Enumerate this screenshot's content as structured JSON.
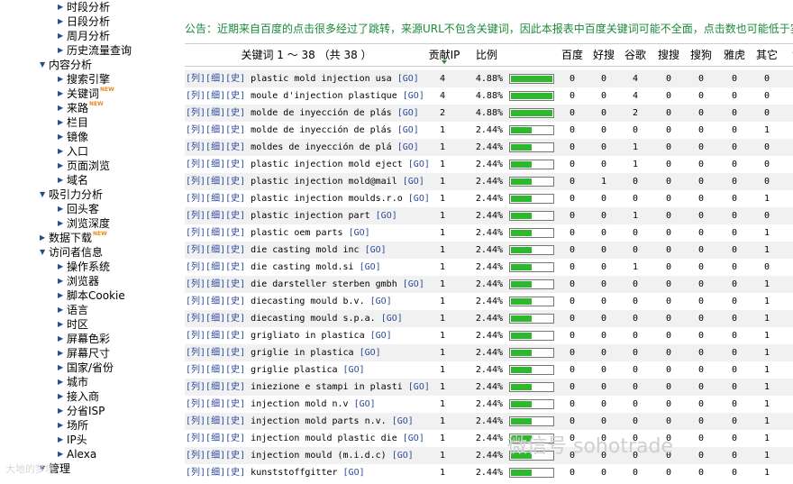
{
  "sidebar": {
    "items": [
      {
        "label": "时段分析",
        "level": 2,
        "arrow": "right"
      },
      {
        "label": "日段分析",
        "level": 2,
        "arrow": "right"
      },
      {
        "label": "周月分析",
        "level": 2,
        "arrow": "right"
      },
      {
        "label": "历史流量查询",
        "level": 2,
        "arrow": "right"
      },
      {
        "label": "内容分析",
        "level": 1,
        "arrow": "down"
      },
      {
        "label": "搜索引擎",
        "level": 2,
        "arrow": "right"
      },
      {
        "label": "关键词",
        "level": 2,
        "arrow": "right",
        "badge": "NEW"
      },
      {
        "label": "来路",
        "level": 2,
        "arrow": "right",
        "badge": "NEW"
      },
      {
        "label": "栏目",
        "level": 2,
        "arrow": "right"
      },
      {
        "label": "镜像",
        "level": 2,
        "arrow": "right"
      },
      {
        "label": "入口",
        "level": 2,
        "arrow": "right"
      },
      {
        "label": "页面浏览",
        "level": 2,
        "arrow": "right"
      },
      {
        "label": "域名",
        "level": 2,
        "arrow": "right"
      },
      {
        "label": "吸引力分析",
        "level": 1,
        "arrow": "down"
      },
      {
        "label": "回头客",
        "level": 2,
        "arrow": "right"
      },
      {
        "label": "浏览深度",
        "level": 2,
        "arrow": "right"
      },
      {
        "label": "数据下载",
        "level": 1,
        "arrow": "right",
        "badge": "NEW"
      },
      {
        "label": "访问者信息",
        "level": 1,
        "arrow": "down"
      },
      {
        "label": "操作系统",
        "level": 2,
        "arrow": "right"
      },
      {
        "label": "浏览器",
        "level": 2,
        "arrow": "right"
      },
      {
        "label": "脚本Cookie",
        "level": 2,
        "arrow": "right"
      },
      {
        "label": "语言",
        "level": 2,
        "arrow": "right"
      },
      {
        "label": "时区",
        "level": 2,
        "arrow": "right"
      },
      {
        "label": "屏幕色彩",
        "level": 2,
        "arrow": "right"
      },
      {
        "label": "屏幕尺寸",
        "level": 2,
        "arrow": "right"
      },
      {
        "label": "国家/省份",
        "level": 2,
        "arrow": "right"
      },
      {
        "label": "城市",
        "level": 2,
        "arrow": "right"
      },
      {
        "label": "接入商",
        "level": 2,
        "arrow": "right"
      },
      {
        "label": "分省ISP",
        "level": 2,
        "arrow": "right"
      },
      {
        "label": "场所",
        "level": 2,
        "arrow": "right"
      },
      {
        "label": "IP头",
        "level": 2,
        "arrow": "right"
      },
      {
        "label": "Alexa",
        "level": 2,
        "arrow": "right"
      },
      {
        "label": "管理",
        "level": 1,
        "arrow": "down"
      }
    ]
  },
  "notice": "公告：近期来自百度的点击很多经过了跳转，来源URL不包含关键词，因此本报表中百度关键词可能不全面，点击数也可能低于实",
  "header": {
    "keyword": "关键词 1 ～ 38 （共 38 ）",
    "ip": "贡献IP",
    "ratio": "比例",
    "engines": [
      "百度",
      "好搜",
      "谷歌",
      "搜搜",
      "搜狗",
      "雅虎",
      "其它",
      "贡"
    ]
  },
  "link_labels": {
    "col": "[列]",
    "detail": "[细]",
    "history": "[史]",
    "go": "[GO]"
  },
  "rows": [
    {
      "keyword": "plastic mold injection usa",
      "ip": 4,
      "pct": "4.88%",
      "share": 1.0,
      "engines": [
        0,
        0,
        4,
        0,
        0,
        0,
        0
      ]
    },
    {
      "keyword": "moule d'injection plastique",
      "ip": 4,
      "pct": "4.88%",
      "share": 1.0,
      "engines": [
        0,
        0,
        4,
        0,
        0,
        0,
        0
      ]
    },
    {
      "keyword": "molde de inyección de plás",
      "ip": 2,
      "pct": "4.88%",
      "share": 1.0,
      "engines": [
        0,
        0,
        2,
        0,
        0,
        0,
        0
      ]
    },
    {
      "keyword": "molde de inyección de plás",
      "ip": 1,
      "pct": "2.44%",
      "share": 0.5,
      "engines": [
        0,
        0,
        0,
        0,
        0,
        0,
        1
      ]
    },
    {
      "keyword": "moldes de inyección de plá",
      "ip": 1,
      "pct": "2.44%",
      "share": 0.5,
      "engines": [
        0,
        0,
        1,
        0,
        0,
        0,
        0
      ]
    },
    {
      "keyword": "plastic injection mold eject",
      "ip": 1,
      "pct": "2.44%",
      "share": 0.5,
      "engines": [
        0,
        0,
        1,
        0,
        0,
        0,
        0
      ]
    },
    {
      "keyword": "plastic injection mold@mail",
      "ip": 1,
      "pct": "2.44%",
      "share": 0.5,
      "engines": [
        0,
        1,
        0,
        0,
        0,
        0,
        0
      ]
    },
    {
      "keyword": "plastic injection moulds.r.o",
      "ip": 1,
      "pct": "2.44%",
      "share": 0.5,
      "engines": [
        0,
        0,
        0,
        0,
        0,
        0,
        1
      ]
    },
    {
      "keyword": "plastic injection part",
      "ip": 1,
      "pct": "2.44%",
      "share": 0.5,
      "engines": [
        0,
        0,
        1,
        0,
        0,
        0,
        0
      ]
    },
    {
      "keyword": "plastic oem parts",
      "ip": 1,
      "pct": "2.44%",
      "share": 0.5,
      "engines": [
        0,
        0,
        0,
        0,
        0,
        0,
        1
      ]
    },
    {
      "keyword": "die casting mold inc",
      "ip": 1,
      "pct": "2.44%",
      "share": 0.5,
      "engines": [
        0,
        0,
        0,
        0,
        0,
        0,
        1
      ]
    },
    {
      "keyword": "die casting mold.si",
      "ip": 1,
      "pct": "2.44%",
      "share": 0.5,
      "engines": [
        0,
        0,
        1,
        0,
        0,
        0,
        0
      ]
    },
    {
      "keyword": "die darsteller sterben gmbh",
      "ip": 1,
      "pct": "2.44%",
      "share": 0.5,
      "engines": [
        0,
        0,
        0,
        0,
        0,
        0,
        1
      ]
    },
    {
      "keyword": "diecasting mould b.v.",
      "ip": 1,
      "pct": "2.44%",
      "share": 0.5,
      "engines": [
        0,
        0,
        0,
        0,
        0,
        0,
        1
      ]
    },
    {
      "keyword": "diecasting mould s.p.a.",
      "ip": 1,
      "pct": "2.44%",
      "share": 0.5,
      "engines": [
        0,
        0,
        0,
        0,
        0,
        0,
        1
      ]
    },
    {
      "keyword": "grigliato in plastica",
      "ip": 1,
      "pct": "2.44%",
      "share": 0.5,
      "engines": [
        0,
        0,
        0,
        0,
        0,
        0,
        1
      ]
    },
    {
      "keyword": "griglie in plastica",
      "ip": 1,
      "pct": "2.44%",
      "share": 0.5,
      "engines": [
        0,
        0,
        0,
        0,
        0,
        0,
        1
      ]
    },
    {
      "keyword": "griglie plastica",
      "ip": 1,
      "pct": "2.44%",
      "share": 0.5,
      "engines": [
        0,
        0,
        0,
        0,
        0,
        0,
        1
      ]
    },
    {
      "keyword": "iniezione e stampi in plasti",
      "ip": 1,
      "pct": "2.44%",
      "share": 0.5,
      "engines": [
        0,
        0,
        0,
        0,
        0,
        0,
        1
      ]
    },
    {
      "keyword": "injection mold n.v",
      "ip": 1,
      "pct": "2.44%",
      "share": 0.5,
      "engines": [
        0,
        0,
        0,
        0,
        0,
        0,
        1
      ]
    },
    {
      "keyword": "injection mold parts n.v.",
      "ip": 1,
      "pct": "2.44%",
      "share": 0.5,
      "engines": [
        0,
        0,
        0,
        0,
        0,
        0,
        1
      ]
    },
    {
      "keyword": "injection mould plastic die",
      "ip": 1,
      "pct": "2.44%",
      "share": 0.5,
      "engines": [
        0,
        0,
        0,
        0,
        0,
        0,
        1
      ]
    },
    {
      "keyword": "injection mould (m.i.d.c)",
      "ip": 1,
      "pct": "2.44%",
      "share": 0.5,
      "engines": [
        0,
        0,
        0,
        0,
        0,
        0,
        1
      ]
    },
    {
      "keyword": "kunststoffgitter",
      "ip": 1,
      "pct": "2.44%",
      "share": 0.5,
      "engines": [
        0,
        0,
        0,
        0,
        0,
        0,
        1
      ]
    }
  ],
  "watermark": "微信号 sohotrade",
  "watermark_left": "大地的梦境",
  "colors": {
    "notice": "#1a8a3a",
    "bar_fill": "#2db82d",
    "link": "#2a4a9c",
    "badge": "#e88a1a"
  }
}
